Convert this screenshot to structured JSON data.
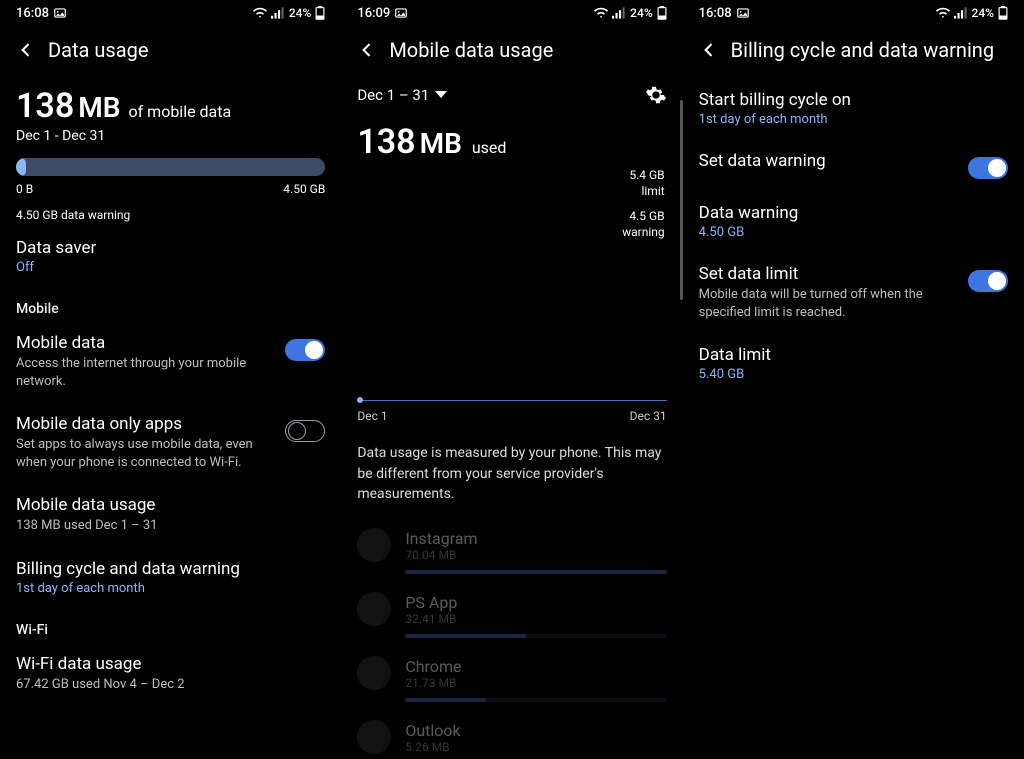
{
  "accent_color": "#8ab4f8",
  "panel1": {
    "time": "16:08",
    "battery": "24%",
    "title": "Data usage",
    "big_amount": "138",
    "big_unit": "MB",
    "big_suffix": "of mobile data",
    "date_range": "Dec 1 - Dec 31",
    "progress_min": "0 B",
    "progress_max": "4.50 GB",
    "warning_note": "4.50 GB data warning",
    "data_saver": {
      "title": "Data saver",
      "value": "Off"
    },
    "section_mobile": "Mobile",
    "mobile_data": {
      "title": "Mobile data",
      "desc": "Access the internet through your mobile network.",
      "on": true
    },
    "only_apps": {
      "title": "Mobile data only apps",
      "desc": "Set apps to always use mobile data, even when your phone is connected to Wi-Fi.",
      "on": false
    },
    "usage": {
      "title": "Mobile data usage",
      "desc": "138 MB used Dec 1 – 31"
    },
    "billing": {
      "title": "Billing cycle and data warning",
      "value": "1st day of each month"
    },
    "section_wifi": "Wi-Fi",
    "wifi_usage": {
      "title": "Wi-Fi data usage",
      "desc": "67.42 GB used Nov 4 – Dec 2"
    }
  },
  "panel2": {
    "time": "16:09",
    "battery": "24%",
    "title": "Mobile data usage",
    "date_range": "Dec 1 – 31",
    "big_amount": "138",
    "big_unit": "MB",
    "used_label": "used",
    "limit_value": "5.4 GB",
    "limit_label": "limit",
    "warn_value": "4.5 GB",
    "warn_label": "warning",
    "chart_start": "Dec 1",
    "chart_end": "Dec 31",
    "note": "Data usage is measured by your phone. This may be different from your service provider's measurements.",
    "apps": [
      {
        "name": "Instagram",
        "usage": "70.04 MB",
        "pct": 100
      },
      {
        "name": "PS App",
        "usage": "32.41 MB",
        "pct": 46
      },
      {
        "name": "Chrome",
        "usage": "21.73 MB",
        "pct": 31
      },
      {
        "name": "Outlook",
        "usage": "5.26 MB",
        "pct": 8
      }
    ]
  },
  "panel3": {
    "time": "16:08",
    "battery": "24%",
    "title": "Billing cycle and data warning",
    "start_cycle": {
      "title": "Start billing cycle on",
      "value": "1st day of each month"
    },
    "set_warning": {
      "title": "Set data warning",
      "on": true
    },
    "data_warning": {
      "title": "Data warning",
      "value": "4.50 GB"
    },
    "set_limit": {
      "title": "Set data limit",
      "desc": "Mobile data will be turned off when the specified limit is reached.",
      "on": true
    },
    "data_limit": {
      "title": "Data limit",
      "value": "5.40 GB"
    }
  },
  "chart_data": {
    "type": "bar",
    "title": "Per-app mobile data usage (Dec 1 – 31)",
    "categories": [
      "Instagram",
      "PS App",
      "Chrome",
      "Outlook"
    ],
    "values": [
      70.04,
      32.41,
      21.73,
      5.26
    ],
    "xlabel": "",
    "ylabel": "MB",
    "ylim": [
      0,
      80
    ]
  }
}
